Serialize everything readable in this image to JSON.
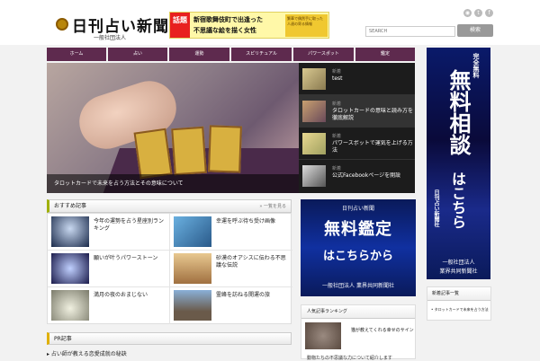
{
  "header": {
    "site_title": "日刊占い新聞",
    "site_subtitle": "一般社団法人",
    "banner": {
      "tag": "話題",
      "line1": "新宿歌舞伎町で出逢った",
      "line2": "不思議な絵を描く女性",
      "side_text": "繁華で偶然手に取った人達の寄る情報"
    },
    "social_icons": [
      "rss-icon",
      "twitter-icon",
      "facebook-icon"
    ],
    "search": {
      "placeholder": "SEARCH",
      "button_label": "検索"
    }
  },
  "nav": {
    "items": [
      "ホーム",
      "占い",
      "運勢",
      "スピリチュアル",
      "パワースポット",
      "鑑定"
    ]
  },
  "hero": {
    "caption": "タロットカードで未来を占う方法とその意味について"
  },
  "side_list": {
    "items": [
      {
        "category": "新着",
        "title": "test"
      },
      {
        "category": "新着",
        "title": "タロットカードの意味と読み方を徹底解説"
      },
      {
        "category": "新着",
        "title": "パワースポットで運気を上げる方法"
      },
      {
        "category": "新着",
        "title": "公式Facebookページを開設"
      }
    ]
  },
  "articles": {
    "header": "おすすめ記事",
    "more": "一覧を見る",
    "items": [
      {
        "title": "今年の運勢を占う星座別ランキング"
      },
      {
        "title": "幸運を呼ぶ待ち受け画像"
      },
      {
        "title": "願いが叶うパワーストーン"
      },
      {
        "title": "砂漠のオアシスに伝わる不思議な伝説"
      },
      {
        "title": "満月の夜のおまじない"
      },
      {
        "title": "霊峰を訪ねる開運の旅"
      }
    ]
  },
  "pr": {
    "header": "PR記事",
    "items": [
      "占い師が教える恋愛成就の秘訣"
    ]
  },
  "ad_mid": {
    "top": "日刊占い新聞",
    "main": "無料鑑定",
    "sub": "はこちらから",
    "bottom": "一般社団法人 業界共同新聞社"
  },
  "popular": {
    "header": "人気記事ランキング",
    "title": "猫が教えてくれる幸せのサイン",
    "excerpt": "動物たちの不思議な力について紹介します"
  },
  "ad_right": {
    "top": "完全無料",
    "main": "無料相談",
    "sub": "はこちら",
    "org": "日刊占い新聞社",
    "bottom1": "一般社団法人",
    "bottom2": "業界共同新聞社"
  },
  "new_articles": {
    "header": "新着記事一覧",
    "items": [
      "タロットカードで未来を占う方法"
    ]
  },
  "colors": {
    "nav": "#5e2a4e",
    "accent": "#a0b000",
    "ad_blue": "#0a1a5a"
  }
}
